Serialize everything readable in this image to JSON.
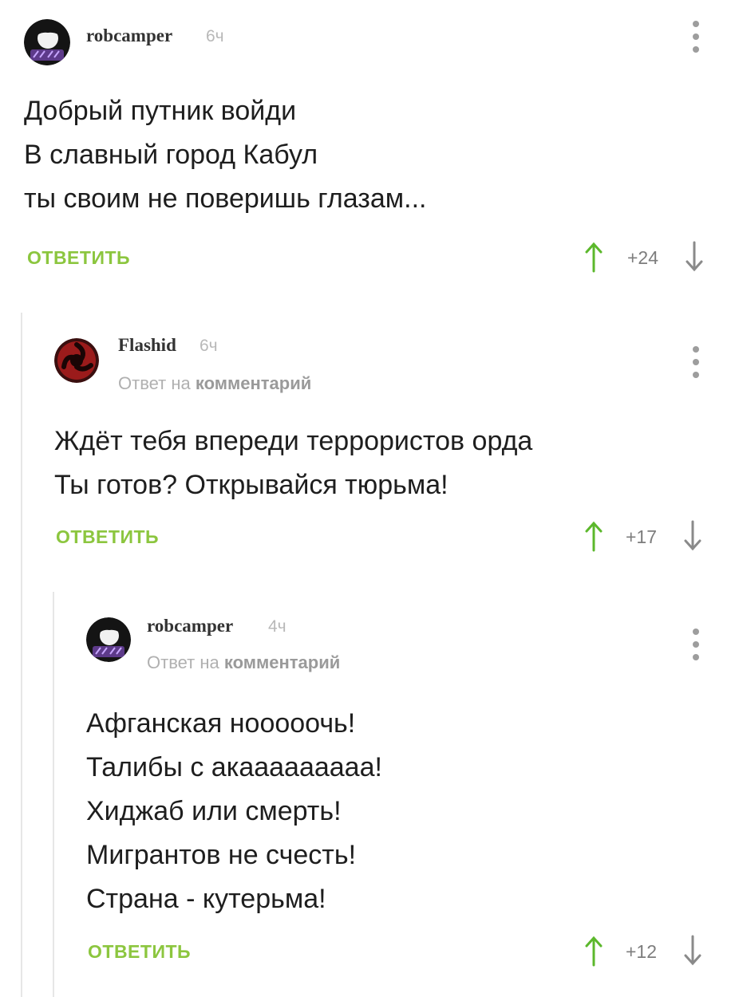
{
  "comments": [
    {
      "author": "robcamper",
      "time": "6ч",
      "reply_to": null,
      "lines": [
        "Добрый путник войди",
        "В славный город Кабул",
        "ты своим не поверишь глазам..."
      ],
      "reply_label": "ОТВЕТИТЬ",
      "score": "+24"
    },
    {
      "author": "Flashid",
      "time": "6ч",
      "reply_to": {
        "prefix": "Ответ на",
        "target": "комментарий"
      },
      "lines": [
        "Ждёт тебя впереди террористов орда",
        "Ты готов? Открывайся тюрьма!"
      ],
      "reply_label": "ОТВЕТИТЬ",
      "score": "+17"
    },
    {
      "author": "robcamper",
      "time": "4ч",
      "reply_to": {
        "prefix": "Ответ на",
        "target": "комментарий"
      },
      "lines": [
        "Афганская нооооочь!",
        "Талибы с акааааааааа!",
        "Хиджаб или смерть!",
        "Мигрантов не счесть!",
        "Страна - кутерьма!"
      ],
      "reply_label": "ОТВЕТИТЬ",
      "score": "+12"
    }
  ],
  "colors": {
    "accent_green": "#8cc63f",
    "upvote_green": "#5cb82c",
    "downvote_gray": "#8a8a8a"
  },
  "icons": {
    "avatar_robcamper": "avatar-robcamper-icon",
    "avatar_flashid": "avatar-flashid-icon",
    "menu": "more-vertical-icon",
    "upvote": "arrow-up-icon",
    "downvote": "arrow-down-icon"
  }
}
